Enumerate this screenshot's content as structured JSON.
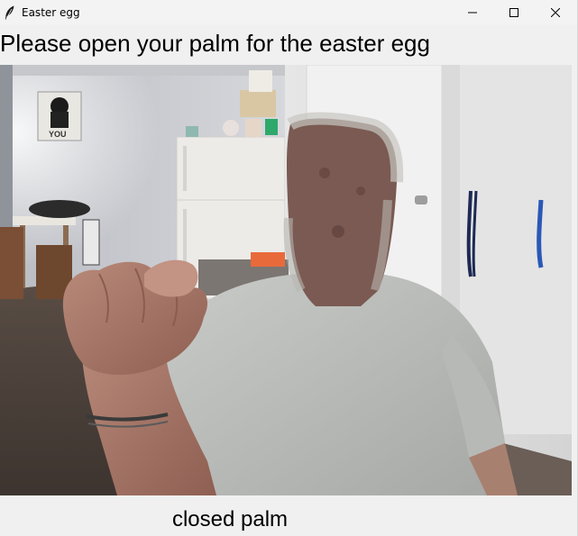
{
  "window": {
    "title": "Easter egg",
    "controls": {
      "minimize": "minimize-icon",
      "maximize": "maximize-icon",
      "close": "close-icon"
    }
  },
  "prompt": {
    "text": "Please open your palm for the easter egg"
  },
  "camera": {
    "description_icon": "webcam-feed"
  },
  "status": {
    "text": "closed palm"
  },
  "colors": {
    "window_bg": "#f0f0f0",
    "titlebar_bg": "#f3f3f3",
    "text": "#000000"
  }
}
